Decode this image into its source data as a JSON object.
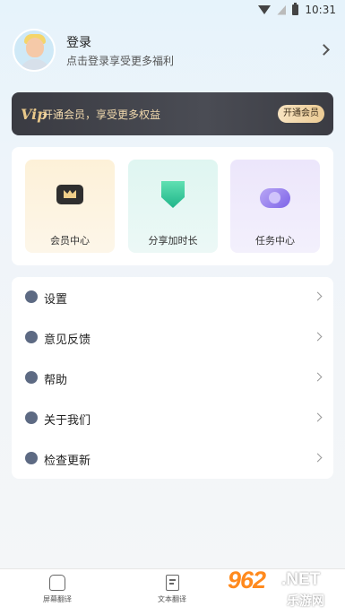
{
  "status_bar": {
    "time": "10:31"
  },
  "profile": {
    "title": "登录",
    "subtitle": "点击登录享受更多福利"
  },
  "vip_banner": {
    "logo": "Vip",
    "text": "开通会员，享受更多权益",
    "button": "开通会员"
  },
  "features": [
    {
      "label": "会员中心",
      "icon": "crown-icon"
    },
    {
      "label": "分享加时长",
      "icon": "share-icon"
    },
    {
      "label": "任务中心",
      "icon": "task-clock-icon"
    }
  ],
  "menu": [
    {
      "label": "设置",
      "icon": "settings-icon"
    },
    {
      "label": "意见反馈",
      "icon": "feedback-icon"
    },
    {
      "label": "帮助",
      "icon": "help-icon"
    },
    {
      "label": "关于我们",
      "icon": "about-icon"
    },
    {
      "label": "检查更新",
      "icon": "update-icon"
    }
  ],
  "tabbar": [
    {
      "label": "屏幕翻译"
    },
    {
      "label": "文本翻译"
    }
  ],
  "watermark": {
    "num": "962",
    "net": ".NET",
    "cn": "乐游网"
  }
}
